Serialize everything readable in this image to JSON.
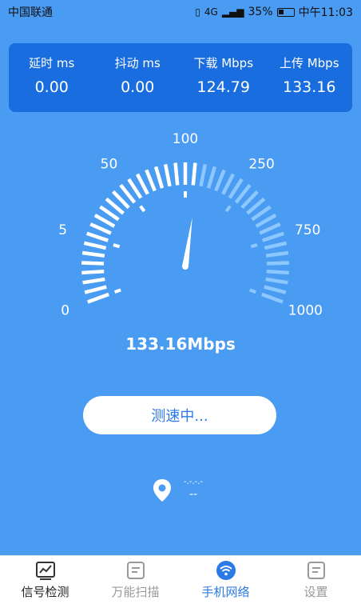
{
  "status_bar": {
    "carrier": "中国联通",
    "network": "4G",
    "battery": "35%",
    "time": "中午11:03"
  },
  "stats": [
    {
      "label": "延时 ms",
      "value": "0.00"
    },
    {
      "label": "抖动 ms",
      "value": "0.00"
    },
    {
      "label": "下载 Mbps",
      "value": "124.79"
    },
    {
      "label": "上传 Mbps",
      "value": "133.16"
    }
  ],
  "gauge": {
    "scale_labels": [
      "0",
      "5",
      "50",
      "100",
      "250",
      "750",
      "1000"
    ],
    "needle_value": 133.16,
    "readout": "133.16Mbps",
    "colors": {
      "filled": "#ffffff",
      "upper": "#8cc8ff",
      "background": "#4a9bf2"
    }
  },
  "test_button": {
    "label": "测速中..."
  },
  "location": {
    "line1": "-.-.-.-",
    "line2": "--"
  },
  "bottom_nav": {
    "items": [
      {
        "label": "信号检测",
        "icon": "chart-icon"
      },
      {
        "label": "万能扫描",
        "icon": "scan-icon"
      },
      {
        "label": "手机网络",
        "icon": "wifi-icon"
      },
      {
        "label": "设置",
        "icon": "settings-icon"
      }
    ],
    "active_index": 2
  }
}
